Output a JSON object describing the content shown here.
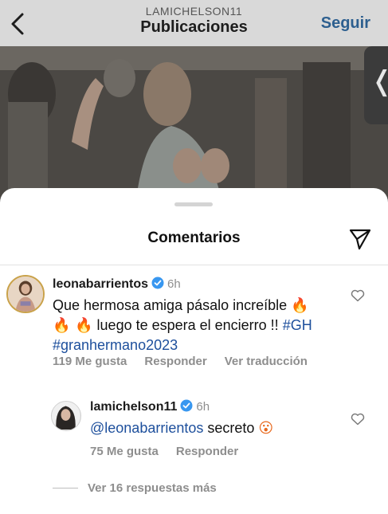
{
  "header": {
    "username": "LAMICHELSON11",
    "title": "Publicaciones",
    "follow_label": "Seguir"
  },
  "side_tab": {
    "glyph": "❬"
  },
  "comments_sheet": {
    "title": "Comentarios",
    "comments": [
      {
        "username": "leonabarrientos",
        "verified": true,
        "time": "6h",
        "text_parts": {
          "p1": "Que hermosa amiga pásalo increíble ",
          "p2": "🔥",
          "p3": "🔥 🔥",
          "p4": " luego te espera el encierro !! ",
          "tag1": "#GH",
          "tag2": "#granhermano2023"
        },
        "likes": "119 Me gusta",
        "reply": "Responder",
        "translate": "Ver traducción"
      },
      {
        "username": "lamichelson11",
        "verified": true,
        "time": "6h",
        "mention": "@leonabarrientos",
        "text_rest": " secreto ",
        "emoji": "😮",
        "likes": "75 Me gusta",
        "reply": "Responder"
      }
    ],
    "more_replies": "Ver 16 respuestas más"
  },
  "colors": {
    "follow": "#2d5f8f",
    "hashtag": "#1d4f9c",
    "verified": "#3897f0",
    "meta": "#8e8e8e"
  }
}
